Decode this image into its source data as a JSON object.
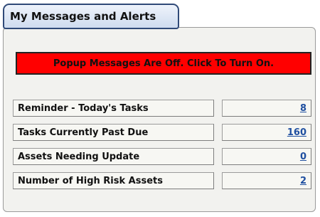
{
  "tab": {
    "title": "My Messages and Alerts"
  },
  "alert": {
    "text": "Popup Messages Are Off. Click To Turn On.",
    "background_color": "#ff0000"
  },
  "rows": [
    {
      "label": "Reminder - Today's Tasks",
      "value": "8"
    },
    {
      "label": "Tasks Currently Past Due",
      "value": "160"
    },
    {
      "label": "Assets Needing Update",
      "value": "0"
    },
    {
      "label": "Number of High Risk Assets",
      "value": "2"
    }
  ],
  "colors": {
    "link": "#1f4fa0",
    "tab_border": "#304a78"
  }
}
